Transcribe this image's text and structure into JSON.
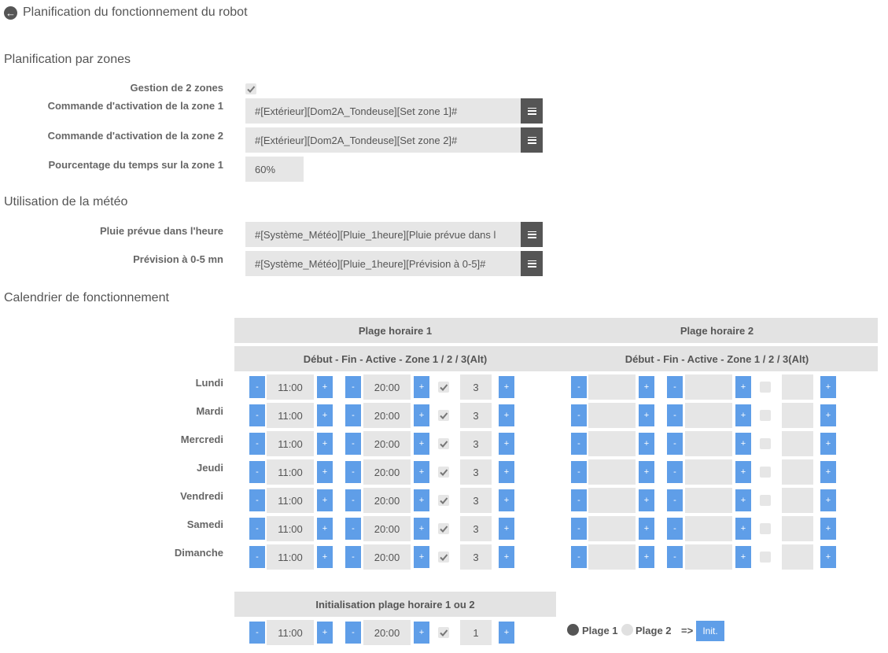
{
  "header": {
    "title": "Planification du fonctionnement du robot"
  },
  "zones": {
    "section_title": "Planification par zones",
    "manage_label": "Gestion de 2 zones",
    "manage_checked": true,
    "cmd1_label": "Commande d'activation de la zone 1",
    "cmd1_value": "#[Extérieur][Dom2A_Tondeuse][Set zone 1]#",
    "cmd2_label": "Commande d'activation de la zone 2",
    "cmd2_value": "#[Extérieur][Dom2A_Tondeuse][Set zone 2]#",
    "pct_label": "Pourcentage du temps sur la zone 1",
    "pct_value": "60%"
  },
  "meteo": {
    "section_title": "Utilisation de la météo",
    "rain_label": "Pluie prévue dans l'heure",
    "rain_value": "#[Système_Météo][Pluie_1heure][Pluie prévue dans l",
    "forecast_label": "Prévision à 0-5 mn",
    "forecast_value": "#[Système_Météo][Pluie_1heure][Prévision à 0-5]#"
  },
  "calendar": {
    "section_title": "Calendrier de fonctionnement",
    "range1_title": "Plage horaire 1",
    "range2_title": "Plage horaire 2",
    "columns_header": "Début - Fin - Active - Zone 1 / 2 / 3(Alt)",
    "minus": "-",
    "plus": "+",
    "days": [
      {
        "name": "Lundi",
        "start": "11:00",
        "end": "20:00",
        "active": true,
        "zone": "3"
      },
      {
        "name": "Mardi",
        "start": "11:00",
        "end": "20:00",
        "active": true,
        "zone": "3"
      },
      {
        "name": "Mercredi",
        "start": "11:00",
        "end": "20:00",
        "active": true,
        "zone": "3"
      },
      {
        "name": "Jeudi",
        "start": "11:00",
        "end": "20:00",
        "active": true,
        "zone": "3"
      },
      {
        "name": "Vendredi",
        "start": "11:00",
        "end": "20:00",
        "active": true,
        "zone": "3"
      },
      {
        "name": "Samedi",
        "start": "11:00",
        "end": "20:00",
        "active": true,
        "zone": "3"
      },
      {
        "name": "Dimanche",
        "start": "11:00",
        "end": "20:00",
        "active": true,
        "zone": "3"
      }
    ]
  },
  "init": {
    "title": "Initialisation plage horaire 1 ou 2",
    "start": "11:00",
    "end": "20:00",
    "active": true,
    "zone": "1",
    "radio1_label": "Plage 1",
    "radio2_label": "Plage 2",
    "arrow": "=>",
    "button_label": "Init.",
    "selected_range": "Plage 1"
  },
  "colors": {
    "accent": "#5f9ee8",
    "field_bg": "#e6e6e6",
    "dark_button": "#555555"
  },
  "icons": {
    "back": "arrow-left-circle-icon",
    "list": "list-icon",
    "check": "check-icon"
  }
}
